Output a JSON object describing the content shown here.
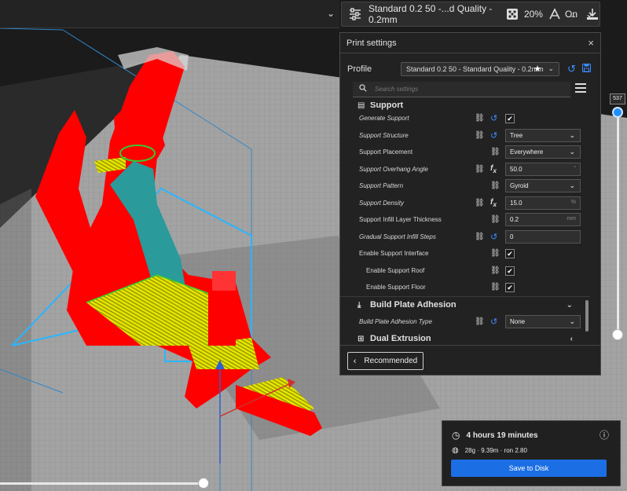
{
  "topbar": {
    "profile_summary": "Standard 0.2 50 -...d Quality - 0.2mm",
    "infill": "20%",
    "support_state": "On",
    "more": "..."
  },
  "panel": {
    "title": "Print settings",
    "close": "×",
    "profile_label": "Profile",
    "profile_value": "Standard 0.2 50 - Standard Quality - 0.2mm",
    "search_placeholder": "Search settings",
    "categories": {
      "support": "Support",
      "adhesion": "Build Plate Adhesion",
      "dual": "Dual Extrusion"
    },
    "settings": [
      {
        "label": "Generate Support",
        "value": "✔"
      },
      {
        "label": "Support Structure",
        "value": "Tree"
      },
      {
        "label": "Support Placement",
        "value": "Everywhere"
      },
      {
        "label": "Support Overhang Angle",
        "value": "50.0",
        "unit": "°"
      },
      {
        "label": "Support Pattern",
        "value": "Gyroid"
      },
      {
        "label": "Support Density",
        "value": "15.0",
        "unit": "%"
      },
      {
        "label": "Support Infill Layer Thickness",
        "value": "0.2",
        "unit": "mm"
      },
      {
        "label": "Gradual Support Infill Steps",
        "value": "0"
      },
      {
        "label": "Enable Support Interface",
        "value": "✔"
      },
      {
        "label": "Enable Support Roof",
        "value": "✔"
      },
      {
        "label": "Enable Support Floor",
        "value": "✔"
      },
      {
        "label": "Build Plate Adhesion Type",
        "value": "None"
      }
    ],
    "recommended": "Recommended"
  },
  "layer_view": {
    "current_layer": "537"
  },
  "estimate": {
    "time": "4 hours 19 minutes",
    "material": "28g · 9.39m · ron 2.80",
    "save_button": "Save to Disk"
  },
  "colors": {
    "accent": "#1c6ee5",
    "model_red": "#ff0000",
    "support_teal": "#2a9a9a",
    "skin_yellow": "#e6e600",
    "wall_green": "#33cc33",
    "bed_grey": "#9a9a9a"
  }
}
